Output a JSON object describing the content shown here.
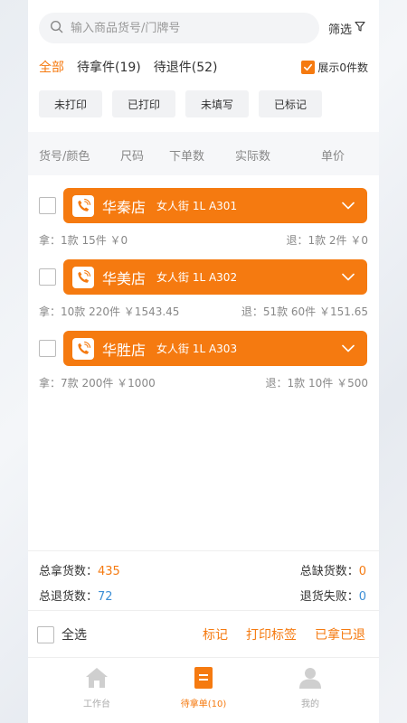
{
  "search": {
    "placeholder": "输入商品货号/门牌号",
    "filter_label": "筛选"
  },
  "tabs": [
    {
      "label": "全部",
      "active": true
    },
    {
      "label": "待拿件(19)",
      "active": false
    },
    {
      "label": "待退件(52)",
      "active": false
    }
  ],
  "show_zero_label": "展示0件数",
  "chips": [
    "未打印",
    "已打印",
    "未填写",
    "已标记"
  ],
  "table_header": {
    "sku_color": "货号/颜色",
    "size": "尺码",
    "ordered": "下单数",
    "actual": "实际数",
    "price": "单价"
  },
  "stores": [
    {
      "name": "华秦店",
      "address": "女人街 1L A301",
      "take": "拿：1款 15件 ￥0",
      "return": "退：1款 2件 ￥0"
    },
    {
      "name": "华美店",
      "address": "女人街 1L A302",
      "take": "拿：10款 220件 ￥1543.45",
      "return": "退：51款 60件 ￥151.65"
    },
    {
      "name": "华胜店",
      "address": "女人街 1L A303",
      "take": "拿：7款 200件 ￥1000",
      "return": "退：1款 10件 ￥500"
    }
  ],
  "totals": {
    "total_take_label": "总拿货数：",
    "total_take_value": "435",
    "total_short_label": "总缺货数：",
    "total_short_value": "0",
    "total_return_label": "总退货数：",
    "total_return_value": "72",
    "return_fail_label": "退货失败：",
    "return_fail_value": "0"
  },
  "actions": {
    "select_all": "全选",
    "mark": "标记",
    "print_label": "打印标签",
    "taken_returned": "已拿已退"
  },
  "nav": [
    {
      "label": "工作台",
      "icon": "home-icon",
      "active": false
    },
    {
      "label": "待拿单(10)",
      "icon": "document-icon",
      "active": true
    },
    {
      "label": "我的",
      "icon": "user-icon",
      "active": false
    }
  ],
  "colors": {
    "accent": "#f57a10",
    "blue": "#3d8fd6",
    "muted": "#888888"
  }
}
